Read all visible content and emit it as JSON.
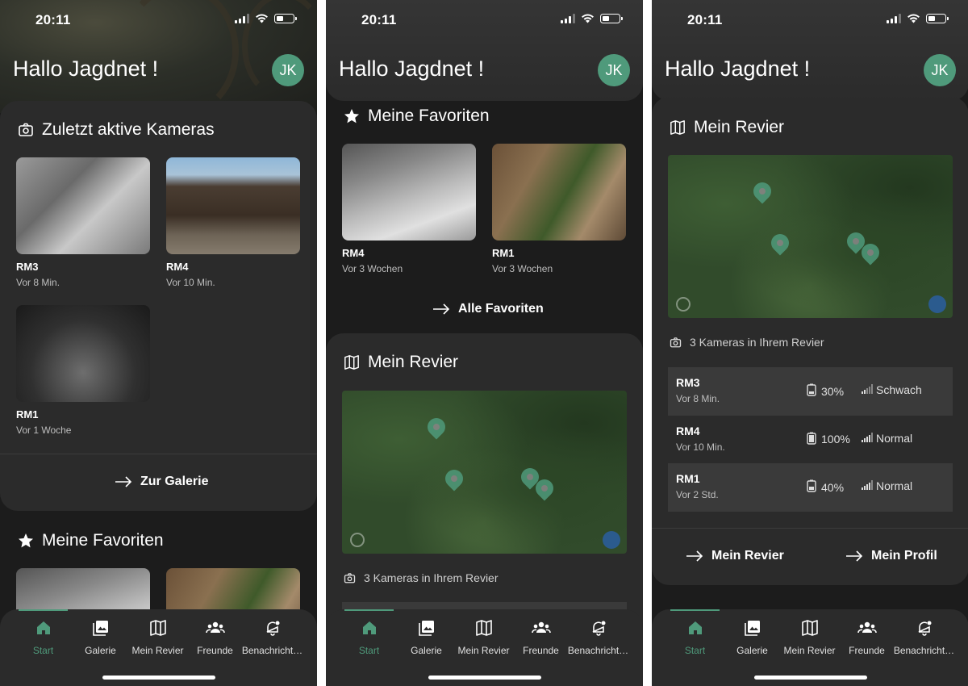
{
  "status": {
    "time": "20:11"
  },
  "header": {
    "greeting": "Hallo Jagdnet !",
    "avatar_initials": "JK"
  },
  "recent": {
    "title": "Zuletzt aktive Kameras",
    "cameras": [
      {
        "name": "RM3",
        "time": "Vor 8 Min."
      },
      {
        "name": "RM4",
        "time": "Vor 10 Min."
      },
      {
        "name": "RM1",
        "time": "Vor 1 Woche"
      }
    ],
    "link": "Zur Galerie"
  },
  "favorites": {
    "title": "Meine Favoriten",
    "cameras": [
      {
        "name": "RM4",
        "time": "Vor 3 Wochen"
      },
      {
        "name": "RM1",
        "time": "Vor 3 Wochen"
      }
    ],
    "link": "Alle Favoriten"
  },
  "revier": {
    "title": "Mein Revier",
    "cameras_count": "3 Kameras in Ihrem Revier",
    "list": [
      {
        "name": "RM3",
        "time": "Vor 8 Min.",
        "battery": "30%",
        "signal": "Schwach"
      },
      {
        "name": "RM4",
        "time": "Vor 10 Min.",
        "battery": "100%",
        "signal": "Normal"
      },
      {
        "name": "RM1",
        "time": "Vor 2 Std.",
        "battery": "40%",
        "signal": "Normal"
      }
    ],
    "link_revier": "Mein Revier",
    "link_profil": "Mein Profil"
  },
  "tabs": [
    {
      "label": "Start",
      "icon": "home-icon"
    },
    {
      "label": "Galerie",
      "icon": "gallery-icon"
    },
    {
      "label": "Mein Revier",
      "icon": "map-icon"
    },
    {
      "label": "Freunde",
      "icon": "friends-icon"
    },
    {
      "label": "Benachricht…",
      "icon": "bell-icon"
    }
  ],
  "colors": {
    "accent": "#4f9a7b",
    "background": "#1c1c1c",
    "card": "#2b2b2b"
  }
}
